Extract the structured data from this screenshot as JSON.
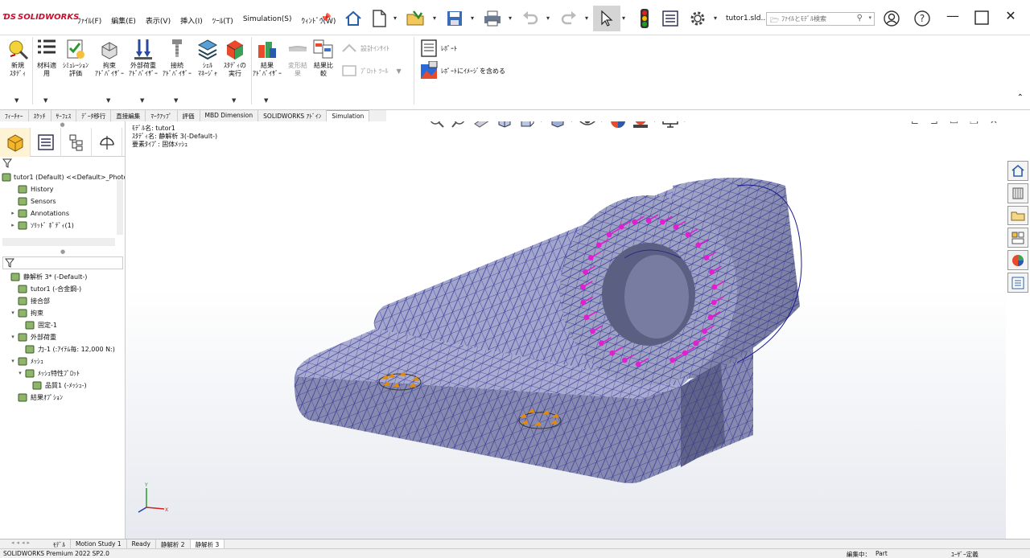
{
  "app": {
    "brand": "SOLIDWORKS",
    "menu": [
      "ﾌｧｲﾙ(F)",
      "編集(E)",
      "表示(V)",
      "挿入(I)",
      "ﾂｰﾙ(T)",
      "Simulation(S)",
      "ｳｨﾝﾄﾞｳ(W)"
    ],
    "document_title": "tutor1.sld...",
    "search_placeholder": "ﾌｧｲﾙとﾓﾃﾞﾙ検索"
  },
  "ribbon": {
    "buttons": [
      {
        "label1": "新規",
        "label2": "ｽﾀﾃﾞｨ",
        "icon": "new-study-icon"
      },
      {
        "label1": "材料適",
        "label2": "用",
        "icon": "apply-material-icon"
      },
      {
        "label1": "ｼﾐｭﾚｰｼｮﾝ",
        "label2": "評価",
        "icon": "simulation-evaluate-icon"
      },
      {
        "label1": "拘束",
        "label2": "ｱﾄﾞﾊﾞｲｻﾞｰ",
        "icon": "fixture-advisor-icon"
      },
      {
        "label1": "外部荷重",
        "label2": "ｱﾄﾞﾊﾞｲｻﾞｰ",
        "icon": "external-loads-advisor-icon"
      },
      {
        "label1": "接続",
        "label2": "ｱﾄﾞﾊﾞｲｻﾞｰ",
        "icon": "connections-advisor-icon"
      },
      {
        "label1": "ｼｪﾙ",
        "label2": "ﾏﾈｰｼﾞｬ",
        "icon": "shell-manager-icon"
      },
      {
        "label1": "ｽﾀﾃﾞｨの",
        "label2": "実行",
        "icon": "run-study-icon"
      },
      {
        "label1": "結果",
        "label2": "ｱﾄﾞﾊﾞｲｻﾞｰ",
        "icon": "results-advisor-icon"
      },
      {
        "label1": "変形結",
        "label2": "果",
        "icon": "deformed-result-icon",
        "disabled": true
      },
      {
        "label1": "結果比",
        "label2": "較",
        "icon": "compare-results-icon"
      }
    ],
    "design_insight": "設計ｲﾝｻｲﾄ",
    "plot_tools": "ﾌﾟﾛｯﾄ ﾂｰﾙ",
    "report": "ﾚﾎﾟｰﾄ",
    "include_image": "ﾚﾎﾟｰﾄにｲﾒｰｼﾞを含める"
  },
  "command_tabs": [
    "ﾌｨｰﾁｬｰ",
    "ｽｹｯﾁ",
    "ｻｰﾌｪｽ",
    "ﾃﾞｰﾀ移行",
    "直接編集",
    "ﾏｰｸｱｯﾌﾟ",
    "評価",
    "MBD Dimension",
    "SOLIDWORKS ｱﾄﾞｲﾝ",
    "Simulation"
  ],
  "feature_tree": [
    {
      "label": "tutor1 (Default) <<Default>_PhotoV",
      "icon": "part-icon",
      "indent": 0,
      "expand": ""
    },
    {
      "label": "History",
      "icon": "history-icon",
      "indent": 1,
      "expand": ""
    },
    {
      "label": "Sensors",
      "icon": "sensors-icon",
      "indent": 1,
      "expand": ""
    },
    {
      "label": "Annotations",
      "icon": "annotations-icon",
      "indent": 1,
      "expand": "▸"
    },
    {
      "label": "ｿﾘｯﾄﾞ ﾎﾞﾃﾞｨ(1)",
      "icon": "solid-bodies-icon",
      "indent": 1,
      "expand": "▸"
    }
  ],
  "sim_tree": [
    {
      "label": "静解析 3* (-Default-)",
      "icon": "static-study-icon",
      "indent": 0,
      "expand": ""
    },
    {
      "label": "tutor1 (-合金鋼-)",
      "icon": "part-material-icon",
      "indent": 1,
      "expand": ""
    },
    {
      "label": "接合部",
      "icon": "connections-icon",
      "indent": 1,
      "expand": ""
    },
    {
      "label": "拘束",
      "icon": "fixtures-icon",
      "indent": 1,
      "expand": "▾"
    },
    {
      "label": "固定-1",
      "icon": "fixed-icon",
      "indent": 2,
      "expand": ""
    },
    {
      "label": "外部荷重",
      "icon": "external-loads-icon",
      "indent": 1,
      "expand": "▾"
    },
    {
      "label": "力-1 (:ｱｲﾃﾑ毎: 12,000 N:)",
      "icon": "force-icon",
      "indent": 2,
      "expand": ""
    },
    {
      "label": "ﾒｯｼｭ",
      "icon": "mesh-icon",
      "indent": 1,
      "expand": "▾"
    },
    {
      "label": "ﾒｯｼｭ特性ﾌﾟﾛｯﾄ",
      "icon": "mesh-plot-folder-icon",
      "indent": 2,
      "expand": "▾"
    },
    {
      "label": "品質1 (-ﾒｯｼｭ-)",
      "icon": "mesh-quality-icon",
      "indent": 3,
      "expand": ""
    },
    {
      "label": "結果ｵﾌﾟｼｮﾝ",
      "icon": "result-options-icon",
      "indent": 1,
      "expand": ""
    }
  ],
  "viewport": {
    "model_name": "ﾓﾃﾞﾙ名: tutor1",
    "study_name": "ｽﾀﾃﾞｨ名: 静解析 3(-Default-)",
    "element_type": "要素ﾀｲﾌﾟ: 固体ﾒｯｼｭ"
  },
  "bottom_tabs": [
    "ﾓﾃﾞﾙ",
    "Motion Study 1",
    "Ready",
    "静解析 2",
    "静解析 3"
  ],
  "status": {
    "left": "SOLIDWORKS Premium 2022 SP2.0",
    "editing": "編集中：",
    "part": "Part",
    "units": "ﾕｰｻﾞｰ定義"
  },
  "colors": {
    "mesh_line": "#1a1a8c",
    "model_fill": "#9ea3c4",
    "force_arrow": "#e020d0",
    "fixture": "#e08a10"
  }
}
